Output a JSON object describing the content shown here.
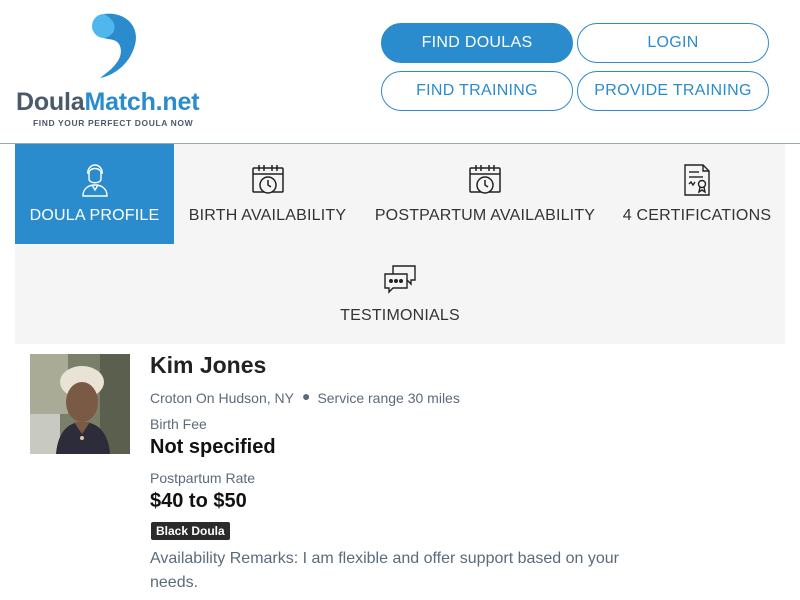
{
  "brand": {
    "name_part1": "Doula",
    "name_part2": "Match.net",
    "tagline": "FIND YOUR PERFECT DOULA NOW",
    "colors": {
      "accent": "#2a8ccc",
      "text_gray": "#4a5a6a",
      "muted": "#5b6b7a"
    }
  },
  "nav": {
    "find_doulas": "FIND DOULAS",
    "login": "LOGIN",
    "find_training": "FIND TRAINING",
    "provide_training": "PROVIDE TRAINING"
  },
  "tabs": [
    {
      "label": "DOULA PROFILE",
      "icon": "doula-person-icon",
      "active": true
    },
    {
      "label": "BIRTH AVAILABILITY",
      "icon": "calendar-clock-icon",
      "active": false
    },
    {
      "label": "POSTPARTUM AVAILABILITY",
      "icon": "calendar-clock-icon",
      "active": false
    },
    {
      "label": "4 CERTIFICATIONS",
      "icon": "certificate-document-icon",
      "active": false
    },
    {
      "label": "TESTIMONIALS",
      "icon": "speech-bubbles-icon",
      "active": false
    }
  ],
  "profile": {
    "name": "Kim Jones",
    "location": "Croton On Hudson, NY",
    "service_range": "Service range 30 miles",
    "birth_fee_label": "Birth Fee",
    "birth_fee_value": "Not specified",
    "postpartum_rate_label": "Postpartum Rate",
    "postpartum_rate_value": "$40 to $50",
    "badge": "Black Doula",
    "remarks": "Availability Remarks: I am flexible and offer support based on your needs."
  }
}
